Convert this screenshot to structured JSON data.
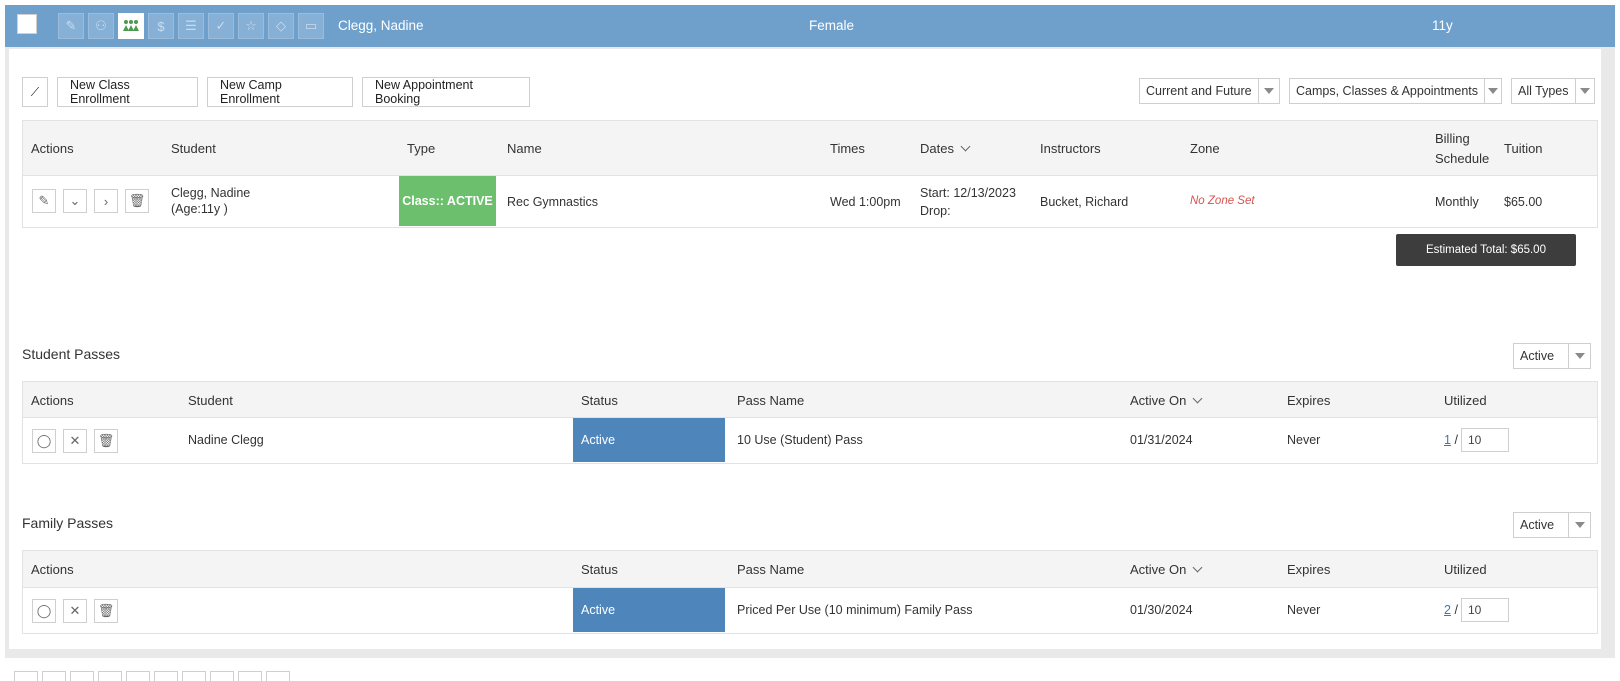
{
  "topbar": {
    "icons": [
      "pencil-icon",
      "users-search-icon",
      "family-icon",
      "dollar-icon",
      "list-icon",
      "check-icon",
      "star-icon",
      "tag-icon",
      "inbox-icon"
    ],
    "student_name": "Clegg, Nadine",
    "gender": "Female",
    "age": "11y"
  },
  "toolbar": {
    "new_class": "New Class Enrollment",
    "new_camp": "New Camp Enrollment",
    "new_appointment": "New Appointment Booking",
    "filter_time": "Current and Future",
    "filter_kind": "Camps, Classes & Appointments",
    "filter_type": "All Types"
  },
  "enrollments": {
    "headers": {
      "actions": "Actions",
      "student": "Student",
      "type": "Type",
      "name": "Name",
      "times": "Times",
      "dates": "Dates",
      "instructors": "Instructors",
      "zone": "Zone",
      "billing_1": "Billing",
      "billing_2": "Schedule",
      "tuition": "Tuition"
    },
    "row": {
      "student_name": "Clegg, Nadine",
      "student_age": "(Age:11y )",
      "type": "Class:: ACTIVE",
      "name": "Rec Gymnastics",
      "times": "Wed 1:00pm",
      "start": "Start: 12/13/2023",
      "drop": "Drop:",
      "instructors": "Bucket, Richard",
      "zone": "No Zone Set",
      "billing": "Monthly",
      "tuition": "$65.00"
    },
    "estimated_total": "Estimated Total: $65.00"
  },
  "student_passes": {
    "title": "Student Passes",
    "filter": "Active",
    "headers": {
      "actions": "Actions",
      "student": "Student",
      "status": "Status",
      "pass_name": "Pass Name",
      "active_on": "Active On",
      "expires": "Expires",
      "utilized": "Utilized"
    },
    "row": {
      "student": "Nadine Clegg",
      "status": "Active",
      "pass_name": "10 Use (Student) Pass",
      "active_on": "01/31/2024",
      "expires": "Never",
      "used": "1",
      "sep": "/",
      "total": "10"
    }
  },
  "family_passes": {
    "title": "Family Passes",
    "filter": "Active",
    "headers": {
      "actions": "Actions",
      "status": "Status",
      "pass_name": "Pass Name",
      "active_on": "Active On",
      "expires": "Expires",
      "utilized": "Utilized"
    },
    "row": {
      "status": "Active",
      "pass_name": "Priced Per Use (10 minimum) Family Pass",
      "active_on": "01/30/2024",
      "expires": "Never",
      "used": "2",
      "sep": "/",
      "total": "10"
    }
  },
  "colors": {
    "topbar": "#6fa0cc",
    "class_active": "#6cbf6c",
    "pass_active": "#4e86bc",
    "no_zone": "#d9534f"
  }
}
